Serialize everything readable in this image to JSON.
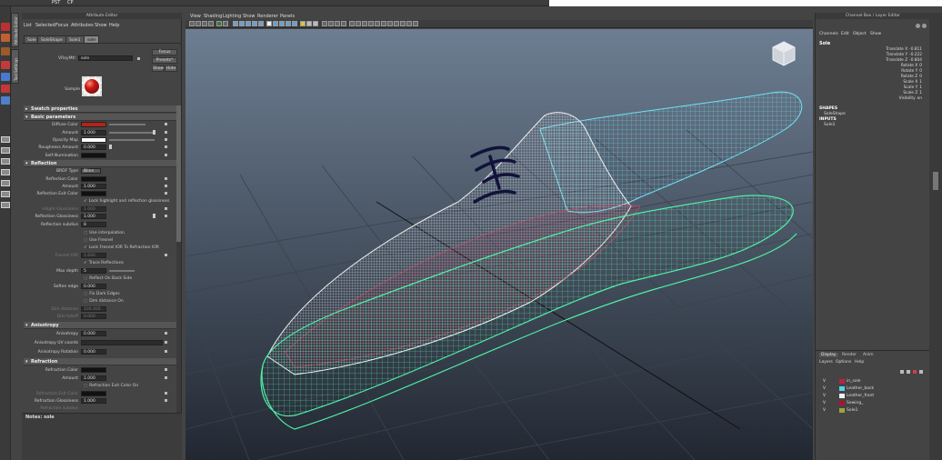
{
  "topbar": {
    "items": [
      "PST",
      "CP"
    ]
  },
  "attribute_editor": {
    "title": "Attribute Editor",
    "menu": [
      "List",
      "Selected",
      "Focus",
      "Attributes",
      "Show",
      "Help"
    ],
    "tabs": [
      "Sole",
      "SoleShape",
      "Sole1",
      "sole"
    ],
    "active_tab": 3,
    "vray_mtl_label": "VRayMtl:",
    "vray_mtl_value": "sole",
    "buttons": {
      "focus": "Focus",
      "presets": "Presets*",
      "show": "Show",
      "hide": "Hide"
    },
    "sample_label": "Sample",
    "sections": {
      "swatch": "Swatch properties",
      "basic": "Basic parameters",
      "reflection": "Reflection",
      "anisotropy": "Anisotropy",
      "refraction": "Refraction"
    },
    "basic": {
      "diffuse_color": "Diffuse Color",
      "amount": "Amount",
      "amount_value": "1.000",
      "opacity_map": "Opacity Map",
      "roughness_amount": "Roughness Amount",
      "roughness_value": "0.000",
      "self_illumination": "Self-Illumination"
    },
    "reflection": {
      "brdf_type": "BRDF Type",
      "brdf_value": "Blinn",
      "reflection_color": "Reflection Color",
      "amount": "Amount",
      "amount_value": "1.000",
      "reflection_exit_color": "Reflection Exit Color",
      "lock_hl": "Lock highlight and reflection glossiness",
      "hilight_glossiness": "Hilight Glossiness",
      "hilight_value": "1.000",
      "reflection_glossiness": "Reflection Glossiness",
      "reflection_glossiness_value": "1.000",
      "reflection_subdivs": "Reflection subdivs",
      "reflection_subdivs_value": "8",
      "use_interpolation": "Use interpolation",
      "use_fresnel": "Use Fresnel",
      "lock_fresnel": "Lock Fresnel IOR To Refraction IOR",
      "fresnel_ior": "Fresnel IOR",
      "fresnel_value": "1.600",
      "trace_reflections": "Trace Reflections",
      "max_depth": "Max depth",
      "max_depth_value": "5",
      "reflect_on_back": "Reflect On Back Side",
      "soften_edge": "Soften edge",
      "soften_edge_value": "0.000",
      "fix_dark_edges": "Fix Dark Edges",
      "dim_distance_on": "Dim distance On",
      "dim_distance": "Dim distance",
      "dim_distance_value": "100.000",
      "dim_falloff": "Dim falloff",
      "dim_falloff_value": "0.000"
    },
    "anisotropy": {
      "anisotropy": "Anisotropy",
      "anisotropy_value": "0.000",
      "uv_coords": "Anisotropy UV coords",
      "rotation": "Anisotropy Rotation",
      "rotation_value": "0.000"
    },
    "refraction": {
      "refraction_color": "Refraction Color",
      "amount": "Amount",
      "amount_value": "1.000",
      "exit_color_on": "Refraction Exit Color On",
      "exit_color": "Refraction Exit Color",
      "glossiness": "Refraction Glossiness",
      "glossiness_value": "1.000",
      "subdivs": "Refraction subdivs"
    },
    "notes_label": "Notes: sole"
  },
  "viewport": {
    "menu": [
      "View",
      "Shading",
      "Lighting",
      "Show",
      "Renderer",
      "Panels"
    ],
    "view_cube": "view-cube"
  },
  "channel_box": {
    "title": "Channel Box / Layer Editor",
    "menu": [
      "Channels",
      "Edit",
      "Object",
      "Show"
    ],
    "object": "Sole",
    "channels": [
      {
        "label": "Translate X",
        "value": "-0.811"
      },
      {
        "label": "Translate Y",
        "value": "-0.222"
      },
      {
        "label": "Translate Z",
        "value": "-0.804"
      },
      {
        "label": "Rotate X",
        "value": "0"
      },
      {
        "label": "Rotate Y",
        "value": "0"
      },
      {
        "label": "Rotate Z",
        "value": "0"
      },
      {
        "label": "Scale X",
        "value": "1"
      },
      {
        "label": "Scale Y",
        "value": "1"
      },
      {
        "label": "Scale Z",
        "value": "1"
      },
      {
        "label": "Visibility",
        "value": "on"
      }
    ],
    "shapes_header": "SHAPES",
    "shape": "SoleShape",
    "inputs_header": "INPUTS",
    "input": "Sole1"
  },
  "layer_editor": {
    "tabs": [
      "Display",
      "Render",
      "Anim"
    ],
    "menu": [
      "Layers",
      "Options",
      "Help"
    ],
    "layers": [
      {
        "v": "V",
        "name": "in_sole",
        "color": "#c02040"
      },
      {
        "v": "V",
        "name": "Leather_back",
        "color": "#5ad0e8"
      },
      {
        "v": "V",
        "name": "Leather_front",
        "color": "#f0f0f0"
      },
      {
        "v": "V",
        "name": "Sewing_",
        "color": "#b01030"
      },
      {
        "v": "V",
        "name": "Sole1",
        "color": "#a0a040"
      }
    ]
  }
}
